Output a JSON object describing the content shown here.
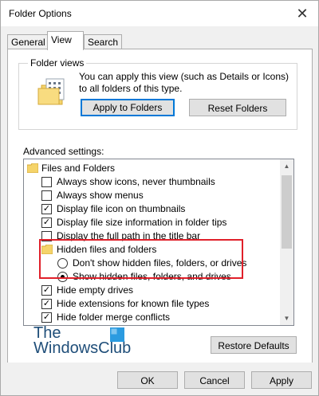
{
  "window": {
    "title": "Folder Options",
    "close_glyph": "✕"
  },
  "tabs": [
    {
      "label": "General"
    },
    {
      "label": "View",
      "active": true
    },
    {
      "label": "Search"
    }
  ],
  "folder_views": {
    "legend": "Folder views",
    "icon": "folder-view-icon",
    "description": "You can apply this view (such as Details or Icons) to all folders of this type.",
    "apply_button": "Apply to Folders",
    "reset_button": "Reset Folders"
  },
  "advanced": {
    "label": "Advanced settings:",
    "items": [
      {
        "type": "folder",
        "label": "Files and Folders"
      },
      {
        "type": "checkbox",
        "label": "Always show icons, never thumbnails",
        "checked": false
      },
      {
        "type": "checkbox",
        "label": "Always show menus",
        "checked": false
      },
      {
        "type": "checkbox",
        "label": "Display file icon on thumbnails",
        "checked": true
      },
      {
        "type": "checkbox",
        "label": "Display file size information in folder tips",
        "checked": true
      },
      {
        "type": "checkbox",
        "label": "Display the full path in the title bar",
        "checked": false
      },
      {
        "type": "folder",
        "label": "Hidden files and folders"
      },
      {
        "type": "radio",
        "label": "Don't show hidden files, folders, or drives",
        "checked": false
      },
      {
        "type": "radio",
        "label": "Show hidden files, folders, and drives",
        "checked": true
      },
      {
        "type": "checkbox",
        "label": "Hide empty drives",
        "checked": true
      },
      {
        "type": "checkbox",
        "label": "Hide extensions for known file types",
        "checked": true
      },
      {
        "type": "checkbox",
        "label": "Hide folder merge conflicts",
        "checked": true
      }
    ]
  },
  "watermark": {
    "line1": "The",
    "line2": "WindowsClub"
  },
  "restore_button": "Restore Defaults",
  "footer": {
    "ok": "OK",
    "cancel": "Cancel",
    "apply": "Apply"
  },
  "colors": {
    "accent": "#0078d7",
    "highlight": "#e0202a",
    "folder": "#f5d46a"
  }
}
